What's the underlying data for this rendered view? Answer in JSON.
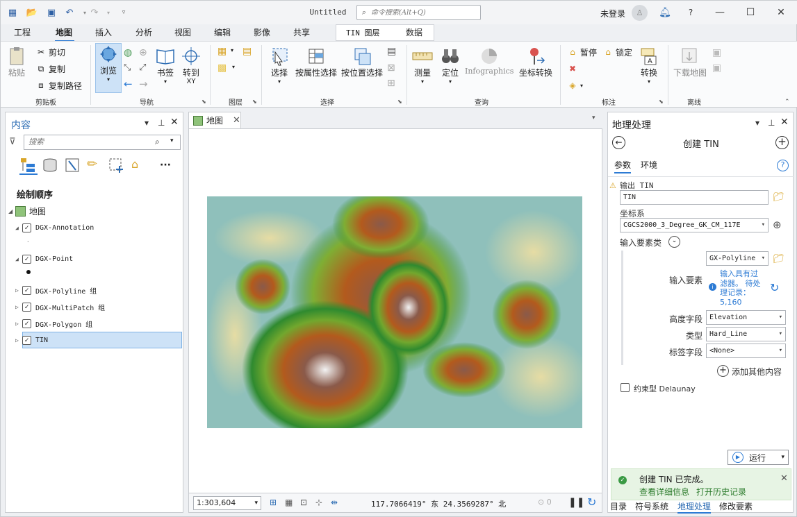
{
  "app": {
    "doc_title": "Untitled",
    "search_placeholder": "命令搜索(Alt+Q)",
    "user": "未登录"
  },
  "ribbon_tabs": [
    "工程",
    "地图",
    "插入",
    "分析",
    "视图",
    "编辑",
    "影像",
    "共享",
    "TIN 图层",
    "数据"
  ],
  "ribbon": {
    "clipboard": {
      "paste": "粘贴",
      "cut": "剪切",
      "copy": "复制",
      "copy_path": "复制路径",
      "label": "剪贴板"
    },
    "navigate": {
      "explore": "浏览",
      "bookmarks": "书签",
      "goto_xy": "转到\nXY",
      "goto_line1": "转到",
      "goto_line2": "XY",
      "label": "导航"
    },
    "layer": {
      "label": "图层"
    },
    "selection": {
      "select": "选择",
      "by_attr": "按属性选择",
      "by_loc": "按位置选择",
      "label": "选择"
    },
    "inquiry": {
      "measure": "测量",
      "locate": "定位",
      "infographics": "Infographics",
      "convert_coords": "坐标转换",
      "label": "查询"
    },
    "labeling": {
      "pause": "暂停",
      "lock": "锁定",
      "convert": "转换",
      "label": "标注"
    },
    "offline": {
      "download": "下载地图",
      "label": "离线"
    }
  },
  "contents": {
    "title": "内容",
    "search_placeholder": "搜索",
    "draw_order": "绘制顺序",
    "map_name": "地图",
    "layers": [
      {
        "name": "DGX-Annotation",
        "checked": true,
        "expanded": true
      },
      {
        "name": "DGX-Point",
        "checked": true,
        "expanded": true
      },
      {
        "name": "DGX-Polyline 组",
        "checked": true,
        "expanded": false
      },
      {
        "name": "DGX-MultiPatch 组",
        "checked": true,
        "expanded": false
      },
      {
        "name": "DGX-Polygon 组",
        "checked": true,
        "expanded": false
      },
      {
        "name": "TIN",
        "checked": true,
        "expanded": false,
        "selected": true
      }
    ]
  },
  "map": {
    "tab_label": "地图",
    "scale": "1:303,604",
    "coordinates": "117.7066419° 东 24.3569287° 北"
  },
  "geoprocessing": {
    "title": "地理处理",
    "tool_name": "创建 TIN",
    "tabs": [
      "参数",
      "环境"
    ],
    "output_tin_label": "输出 TIN",
    "output_tin_value": "TIN",
    "coord_sys_label": "坐标系",
    "coord_sys_value": "CGCS2000_3_Degree_GK_CM_117E",
    "input_features_label": "输入要素类",
    "input_feature_value": "GX-Polyline",
    "input_feature_sublabel": "输入要素",
    "filter_note": "输入具有过滤器。 待处理记录：5,160",
    "filter_line1": "输入具有过",
    "filter_line2": "滤器。 待处",
    "filter_line3": "理记录：",
    "filter_line4": "5,160",
    "height_field_label": "高度字段",
    "height_field_value": "Elevation",
    "type_label": "类型",
    "type_value": "Hard_Line",
    "tag_field_label": "标签字段",
    "tag_field_value": "<None>",
    "add_more": "添加其他内容",
    "constrained_delaunay": "约束型 Delaunay",
    "run_label": "运行",
    "message": "创建 TIN 已完成。",
    "view_details": "查看详细信息",
    "open_history": "打开历史记录"
  },
  "bottom_tabs": [
    "目录",
    "符号系统",
    "地理处理",
    "修改要素"
  ],
  "colors": {
    "accent": "#2d7bd4",
    "selection": "#cde2f7",
    "success_bg": "#e7f4e4"
  }
}
